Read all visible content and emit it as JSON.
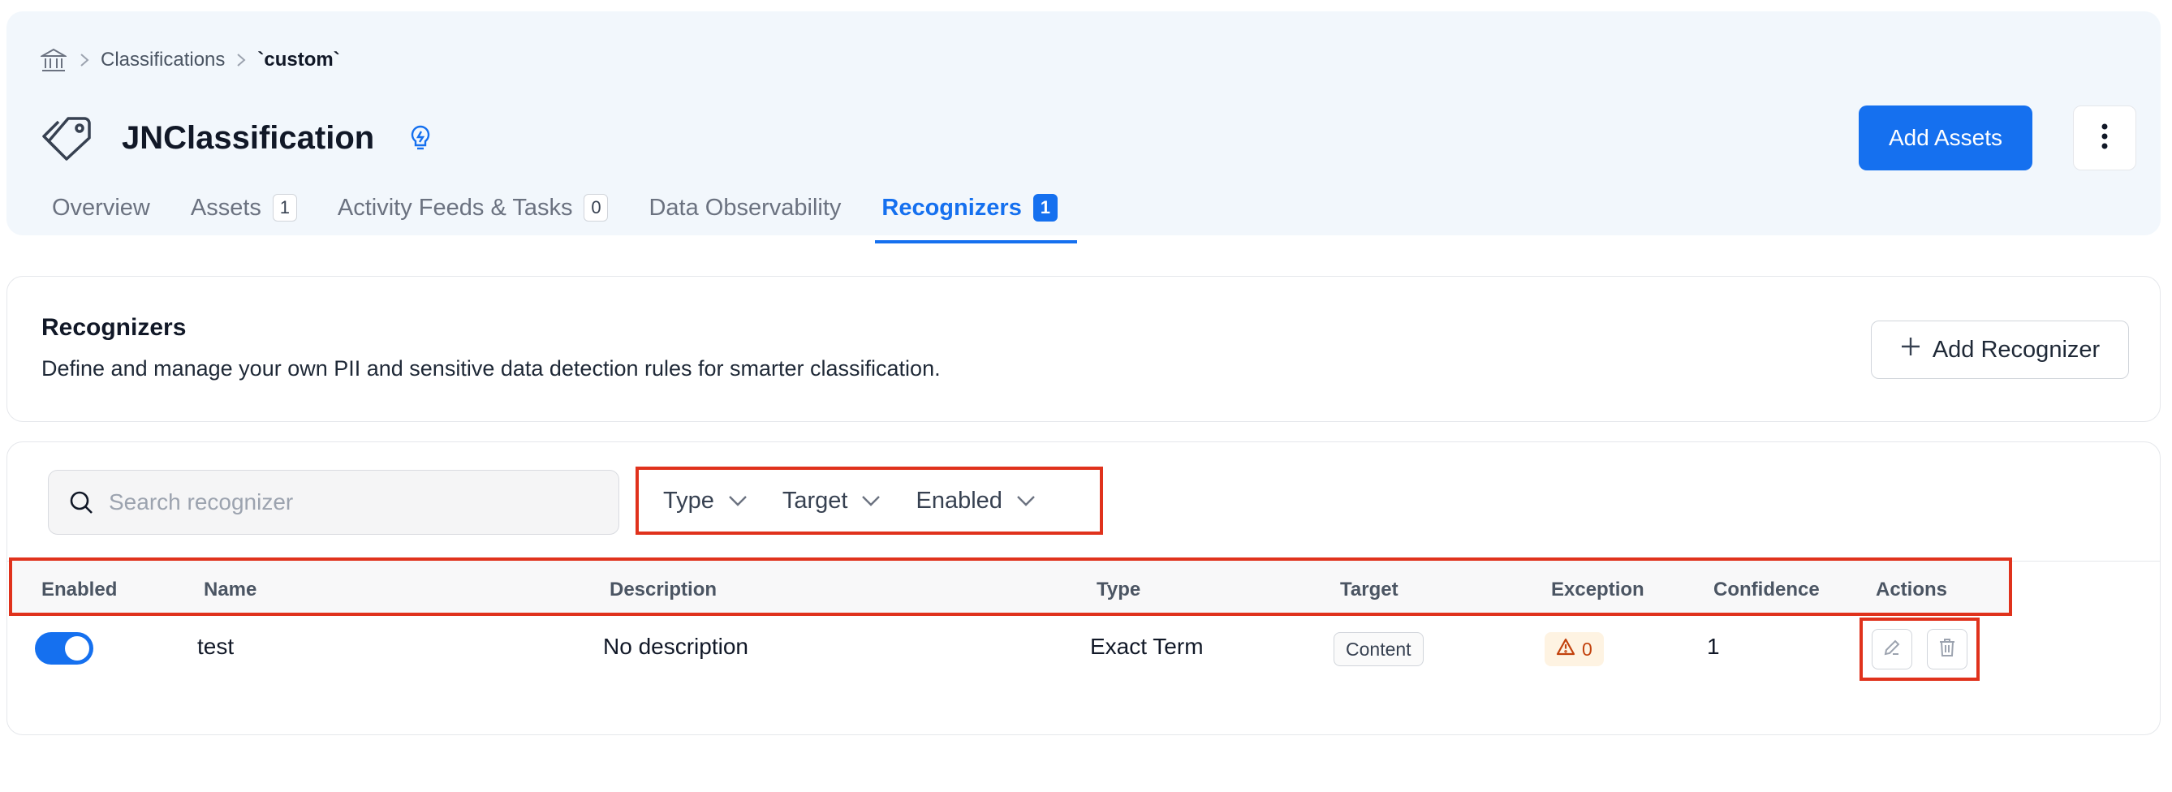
{
  "breadcrumb": {
    "home_icon": "home-icon",
    "items": [
      "Classifications",
      "`custom`"
    ]
  },
  "header": {
    "title": "JNClassification",
    "add_assets_label": "Add Assets",
    "accent_color": "#1570ef"
  },
  "tabs": [
    {
      "label": "Overview",
      "count": null
    },
    {
      "label": "Assets",
      "count": "1"
    },
    {
      "label": "Activity Feeds & Tasks",
      "count": "0"
    },
    {
      "label": "Data Observability",
      "count": null
    },
    {
      "label": "Recognizers",
      "count": "1",
      "active": true
    }
  ],
  "recognizers_panel": {
    "title": "Recognizers",
    "description": "Define and manage your own PII and sensitive data detection rules for smarter classification.",
    "add_button_label": "Add Recognizer"
  },
  "search": {
    "placeholder": "Search recognizer",
    "value": ""
  },
  "filters": [
    "Type",
    "Target",
    "Enabled"
  ],
  "table": {
    "columns": [
      "Enabled",
      "Name",
      "Description",
      "Type",
      "Target",
      "Exception",
      "Confidence",
      "Actions"
    ],
    "rows": [
      {
        "enabled": true,
        "name": "test",
        "description": "No description",
        "type": "Exact Term",
        "target": "Content",
        "exception": "0",
        "confidence": "1"
      }
    ]
  },
  "highlight_color": "#e0321c"
}
